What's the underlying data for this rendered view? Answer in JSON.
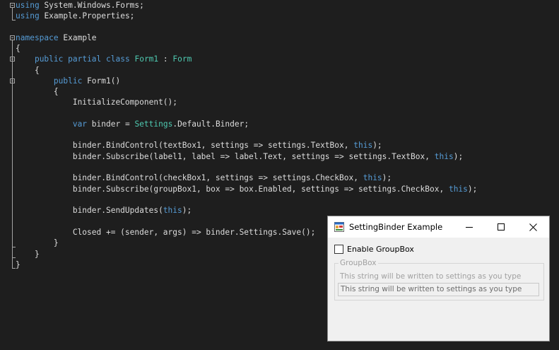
{
  "code": {
    "lines": {
      "l1": [
        "using",
        "System.Windows.Forms;"
      ],
      "l2": [
        "using",
        "Example.Properties;"
      ],
      "l3": [
        "namespace",
        "Example"
      ],
      "l4": "{",
      "l5": [
        "public",
        "partial",
        "class",
        "Form1",
        ":",
        "Form"
      ],
      "l6": "{",
      "l7": [
        "public",
        "Form1()"
      ],
      "l8": "{",
      "l9": "InitializeComponent();",
      "l10": [
        "var",
        "binder =",
        "Settings",
        ".Default.Binder;"
      ],
      "l11": [
        "binder.BindControl(textBox1, settings => settings.TextBox,",
        "this",
        ");"
      ],
      "l12": [
        "binder.Subscribe(label1, label => label.Text, settings => settings.TextBox,",
        "this",
        ");"
      ],
      "l13": [
        "binder.BindControl(checkBox1, settings => settings.CheckBox,",
        "this",
        ");"
      ],
      "l14": [
        "binder.Subscribe(groupBox1, box => box.Enabled, settings => settings.CheckBox,",
        "this",
        ");"
      ],
      "l15": [
        "binder.SendUpdates(",
        "this",
        ");"
      ],
      "l16": "Closed += (sender, args) => binder.Settings.Save();",
      "l17": "}",
      "l18": "}",
      "l19": "}"
    }
  },
  "window": {
    "title": "SettingBinder Example",
    "checkbox_label": "Enable GroupBox",
    "checkbox_checked": false,
    "group_title": "GroupBox",
    "group_label": "This string will be written to settings as you type",
    "group_textbox_value": "This string will be written to settings as you type"
  },
  "icons": {
    "collapse": "collapse-minus-icon",
    "app": "winforms-app-icon",
    "minimize": "minimize-icon",
    "maximize": "maximize-icon",
    "close": "close-icon"
  },
  "colors": {
    "editor_bg": "#1e1e1e",
    "keyword": "#569cd6",
    "type": "#4ec9b0",
    "text": "#dcdcdc",
    "disabled_text": "#a0a0a0"
  }
}
